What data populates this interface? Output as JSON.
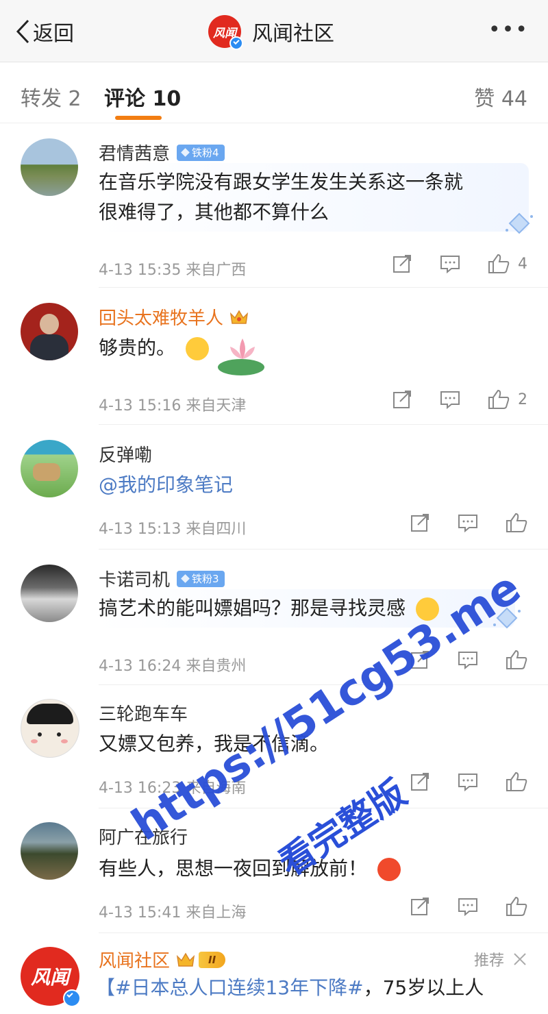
{
  "header": {
    "back_label": "返回",
    "logo_text": "风闻",
    "title": "风闻社区",
    "more_label": "•••"
  },
  "tabs": {
    "repost": "转发 2",
    "comments": "评论 10",
    "likes": "赞 44"
  },
  "comments": [
    {
      "user": "君情茜意",
      "fan_badge": "铁粉4",
      "text_line1": "在音乐学院没有跟女学生发生关系这一条就",
      "text_line2": "很难得了，其他都不算什么",
      "time": "4-13 15:35 来自广西",
      "likes": "4"
    },
    {
      "user": "回头太难牧羊人",
      "text": "够贵的。",
      "time": "4-13 15:16 来自天津",
      "likes": "2"
    },
    {
      "user": "反弹嘞",
      "text": "@我的印象笔记",
      "time": "4-13 15:13 来自四川",
      "likes": ""
    },
    {
      "user": "卡诺司机",
      "fan_badge": "铁粉3",
      "text": "搞艺术的能叫嫖娼吗？那是寻找灵感",
      "time": "4-13 16:24 来自贵州",
      "likes": ""
    },
    {
      "user": "三轮跑车车",
      "text": "又嫖又包养，我是不信滴。",
      "time": "4-13 16:23 来自海南",
      "likes": ""
    },
    {
      "user": "阿广在旅行",
      "text": "有些人，思想一夜回到解放前！",
      "time": "4-13 15:41 来自上海",
      "likes": ""
    }
  ],
  "promo": {
    "user": "风闻社区",
    "level": "II",
    "recommend": "推荐",
    "hashtag": "【#日本总人口连续13年下降#",
    "text_rest": "，75岁以上人"
  },
  "watermark": {
    "line1": "https://51cg53.me",
    "line2": "看完整版"
  },
  "colors": {
    "accent": "#f27d12",
    "brand": "#e12a1f",
    "link": "#4d7bc4",
    "watermark": "#2a4fd8"
  }
}
